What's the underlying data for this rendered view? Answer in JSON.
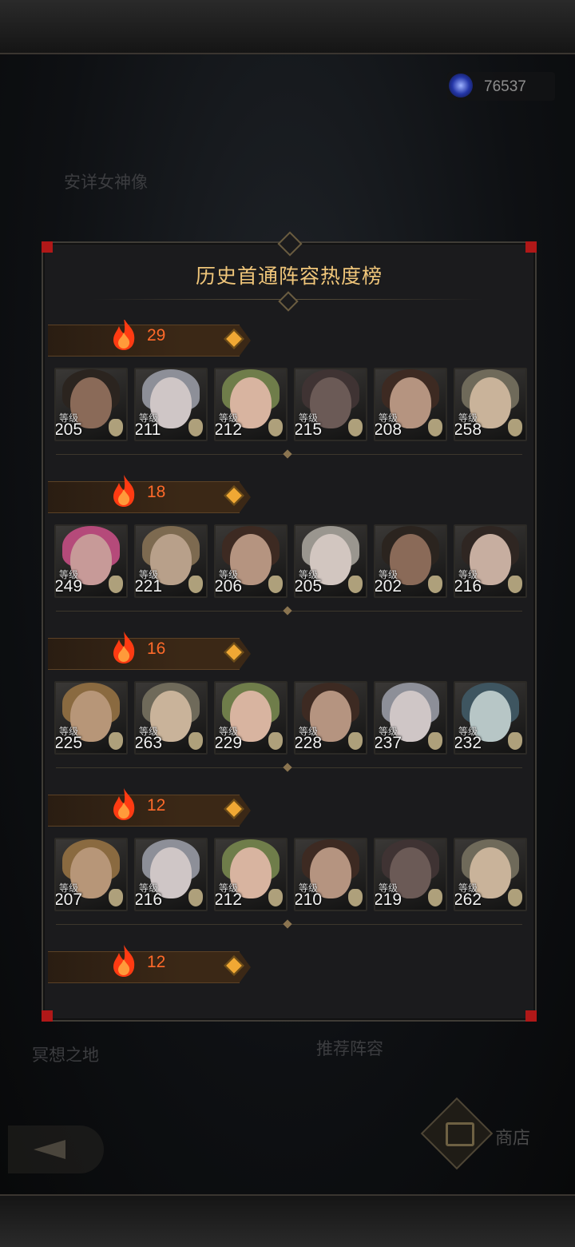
{
  "currency": {
    "icon": "portal-orb-icon",
    "amount": "76537"
  },
  "background": {
    "area_label": "安详女神像",
    "meditation_label": "冥想之地",
    "recommend_label": "推荐阵容",
    "shop_label": "商店"
  },
  "modal": {
    "title": "历史首通阵容热度榜",
    "rows": [
      {
        "heat": "29",
        "heroes": [
          {
            "tag": "等级",
            "level": "205",
            "skin": "#8a6a58",
            "hair": "#2b241f"
          },
          {
            "tag": "等级",
            "level": "211",
            "skin": "#cfc6c6",
            "hair": "#8d8f98"
          },
          {
            "tag": "等级",
            "level": "212",
            "skin": "#d8b4a0",
            "hair": "#6f7d4a"
          },
          {
            "tag": "等级",
            "level": "215",
            "skin": "#6b5a56",
            "hair": "#3f3333"
          },
          {
            "tag": "等级",
            "level": "208",
            "skin": "#b59480",
            "hair": "#3d2a22"
          },
          {
            "tag": "等级",
            "level": "258",
            "skin": "#c9b39a",
            "hair": "#6f6a5a"
          }
        ]
      },
      {
        "heat": "18",
        "heroes": [
          {
            "tag": "等级",
            "level": "249",
            "skin": "#c79a98",
            "hair": "#b54a7a"
          },
          {
            "tag": "等级",
            "level": "221",
            "skin": "#b8a08a",
            "hair": "#7d6a50"
          },
          {
            "tag": "等级",
            "level": "206",
            "skin": "#b59480",
            "hair": "#3d2a22"
          },
          {
            "tag": "等级",
            "level": "205",
            "skin": "#d2c6c0",
            "hair": "#9a968f"
          },
          {
            "tag": "等级",
            "level": "202",
            "skin": "#8a6a58",
            "hair": "#2b241f"
          },
          {
            "tag": "等级",
            "level": "216",
            "skin": "#c7aea0",
            "hair": "#2f2622"
          }
        ]
      },
      {
        "heat": "16",
        "heroes": [
          {
            "tag": "等级",
            "level": "225",
            "skin": "#b79678",
            "hair": "#8a6a40"
          },
          {
            "tag": "等级",
            "level": "263",
            "skin": "#c9b39a",
            "hair": "#6f6a5a"
          },
          {
            "tag": "等级",
            "level": "229",
            "skin": "#d8b4a0",
            "hair": "#6f7d4a"
          },
          {
            "tag": "等级",
            "level": "228",
            "skin": "#b59480",
            "hair": "#3d2a22"
          },
          {
            "tag": "等级",
            "level": "237",
            "skin": "#cfc6c6",
            "hair": "#8d8f98"
          },
          {
            "tag": "等级",
            "level": "232",
            "skin": "#b7c6c6",
            "hair": "#3e5560"
          }
        ]
      },
      {
        "heat": "12",
        "heroes": [
          {
            "tag": "等级",
            "level": "207",
            "skin": "#b79678",
            "hair": "#8a6a40"
          },
          {
            "tag": "等级",
            "level": "216",
            "skin": "#cfc6c6",
            "hair": "#8d8f98"
          },
          {
            "tag": "等级",
            "level": "212",
            "skin": "#d8b4a0",
            "hair": "#6f7d4a"
          },
          {
            "tag": "等级",
            "level": "210",
            "skin": "#b59480",
            "hair": "#3d2a22"
          },
          {
            "tag": "等级",
            "level": "219",
            "skin": "#6b5a56",
            "hair": "#3f3333"
          },
          {
            "tag": "等级",
            "level": "262",
            "skin": "#c9b39a",
            "hair": "#6f6a5a"
          }
        ]
      },
      {
        "heat": "12",
        "heroes": []
      }
    ]
  },
  "colors": {
    "title": "#f0c67a",
    "heat": "#ff6a2a",
    "corner": "#b01818"
  }
}
